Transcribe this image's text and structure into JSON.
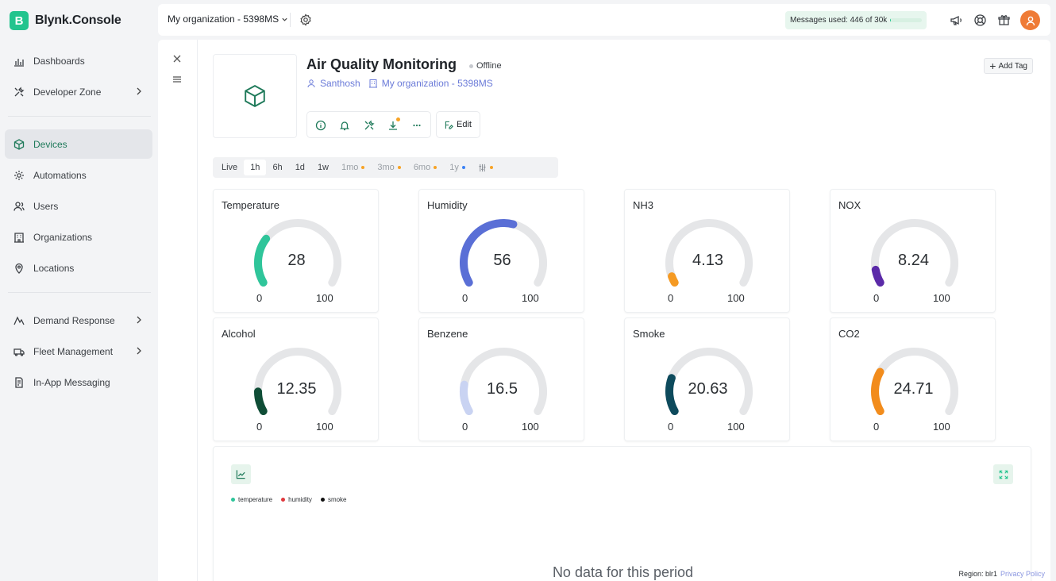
{
  "brand": {
    "badge": "B",
    "name": "Blynk.Console"
  },
  "sidebar": {
    "items": [
      {
        "label": "Dashboards",
        "icon": "dashboard-icon"
      },
      {
        "label": "Developer Zone",
        "icon": "tools-icon",
        "chevron": true
      },
      {
        "label": "Devices",
        "icon": "cube-icon",
        "active": true
      },
      {
        "label": "Automations",
        "icon": "automation-icon"
      },
      {
        "label": "Users",
        "icon": "users-icon"
      },
      {
        "label": "Organizations",
        "icon": "building-icon"
      },
      {
        "label": "Locations",
        "icon": "pin-icon"
      },
      {
        "label": "Demand Response",
        "icon": "demand-icon",
        "chevron": true
      },
      {
        "label": "Fleet Management",
        "icon": "truck-icon",
        "chevron": true
      },
      {
        "label": "In-App Messaging",
        "icon": "message-icon"
      }
    ]
  },
  "topbar": {
    "org": "My organization - 5398MS",
    "messages": "Messages used: 446 of 30k",
    "messages_used_fraction": 0.015
  },
  "device": {
    "title": "Air Quality Monitoring",
    "status": "Offline",
    "owner": "Santhosh",
    "org": "My organization - 5398MS",
    "edit": "Edit",
    "add_tag": "Add Tag"
  },
  "time_tabs": [
    {
      "label": "Live",
      "active": false
    },
    {
      "label": "1h",
      "active": true
    },
    {
      "label": "6h"
    },
    {
      "label": "1d"
    },
    {
      "label": "1w"
    },
    {
      "label": "1mo",
      "dot": "#f7a325",
      "dim": true
    },
    {
      "label": "3mo",
      "dot": "#f7a325",
      "dim": true
    },
    {
      "label": "6mo",
      "dot": "#f7a325",
      "dim": true
    },
    {
      "label": "1y",
      "dot": "#3b82f6",
      "dim": true
    },
    {
      "label": "",
      "icon": "sliders-icon",
      "dot": "#f7a325",
      "dim": true
    }
  ],
  "gauges": [
    {
      "title": "Temperature",
      "value": "28",
      "num": 28,
      "min": "0",
      "max": "100",
      "color": "#2fc59a"
    },
    {
      "title": "Humidity",
      "value": "56",
      "num": 56,
      "min": "0",
      "max": "100",
      "color": "#5a6fd6"
    },
    {
      "title": "NH3",
      "value": "4.13",
      "num": 4.13,
      "min": "0",
      "max": "100",
      "color": "#f59a23"
    },
    {
      "title": "NOX",
      "value": "8.24",
      "num": 8.24,
      "min": "0",
      "max": "100",
      "color": "#5b2aa8"
    },
    {
      "title": "Alcohol",
      "value": "12.35",
      "num": 12.35,
      "min": "0",
      "max": "100",
      "color": "#0f4d36"
    },
    {
      "title": "Benzene",
      "value": "16.5",
      "num": 16.5,
      "min": "0",
      "max": "100",
      "color": "#c9d3f2"
    },
    {
      "title": "Smoke",
      "value": "20.63",
      "num": 20.63,
      "min": "0",
      "max": "100",
      "color": "#0d4a5c"
    },
    {
      "title": "CO2",
      "value": "24.71",
      "num": 24.71,
      "min": "0",
      "max": "100",
      "color": "#f28c1c"
    }
  ],
  "chart": {
    "legend": [
      {
        "label": "temperature",
        "color": "#2fc59a"
      },
      {
        "label": "humidity",
        "color": "#e0393e"
      },
      {
        "label": "smoke",
        "color": "#111111"
      }
    ],
    "empty": "No data for this period"
  },
  "footer": {
    "region": "Region: blr1",
    "privacy": "Privacy Policy"
  },
  "colors": {
    "accent": "#23c48e",
    "accent_dark": "#1f7a5a",
    "link": "#6a7ad8"
  }
}
